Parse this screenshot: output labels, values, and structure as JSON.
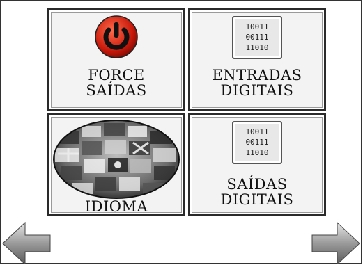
{
  "tiles": [
    {
      "line1": "FORCE",
      "line2": "SAÍDAS",
      "icon": "power-icon"
    },
    {
      "line1": "ENTRADAS",
      "line2": "DIGITAIS",
      "icon": "binary-chip-icon",
      "binary": [
        "10011",
        "00111",
        "11010"
      ]
    },
    {
      "line1": "IDIOMA",
      "line2": "",
      "icon": "globe-flags-icon"
    },
    {
      "line1": "SAÍDAS",
      "line2": "DIGITAIS",
      "icon": "binary-chip-icon",
      "binary": [
        "10011",
        "00111",
        "11010"
      ]
    }
  ],
  "nav": {
    "prev": "arrow-left-icon",
    "next": "arrow-right-icon"
  }
}
